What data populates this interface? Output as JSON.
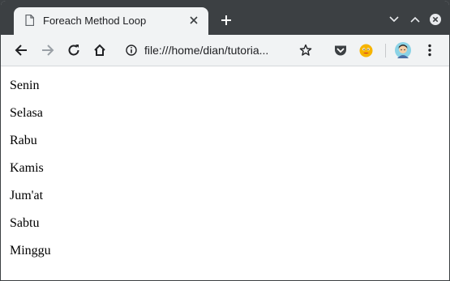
{
  "tab": {
    "title": "Foreach Method Loop"
  },
  "toolbar": {
    "url": "file:///home/dian/tutoria..."
  },
  "days": [
    "Senin",
    "Selasa",
    "Rabu",
    "Kamis",
    "Jum'at",
    "Sabtu",
    "Minggu"
  ]
}
